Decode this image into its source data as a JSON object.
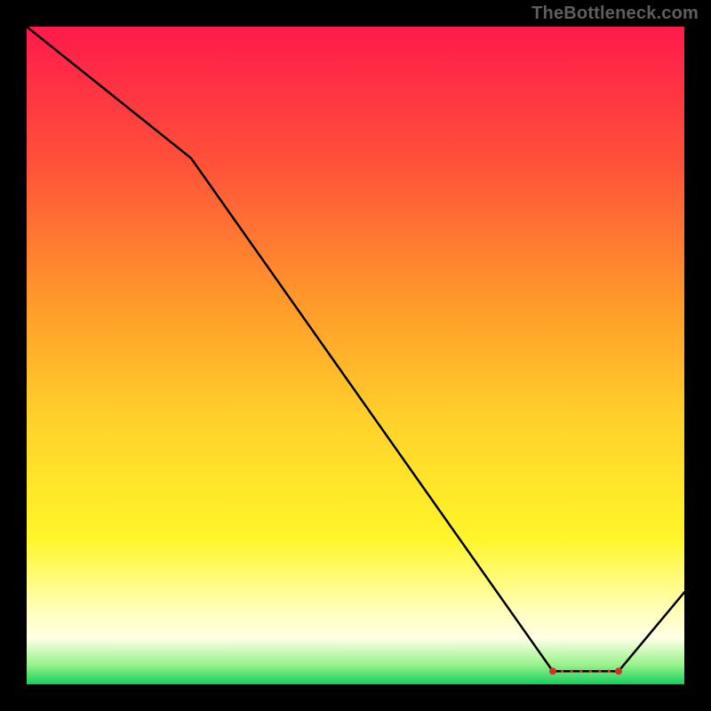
{
  "watermark": "TheBottleneck.com",
  "accent_line_color": "#000000",
  "marker_color": "#d2312a",
  "chart_data": {
    "type": "line",
    "title": "",
    "xlabel": "",
    "ylabel": "",
    "xlim": [
      0,
      100
    ],
    "ylim": [
      0,
      100
    ],
    "x": [
      0,
      25,
      80,
      90,
      100
    ],
    "y": [
      100,
      80,
      2,
      2,
      14
    ],
    "optimal_range": {
      "x_start": 80,
      "x_end": 90,
      "y": 2
    },
    "gradient_stops": [
      {
        "offset": 0.0,
        "color": "#ff1a4b"
      },
      {
        "offset": 0.2,
        "color": "#ff4f3a"
      },
      {
        "offset": 0.42,
        "color": "#ff9a2a"
      },
      {
        "offset": 0.6,
        "color": "#ffd22a"
      },
      {
        "offset": 0.78,
        "color": "#fff62a"
      },
      {
        "offset": 0.88,
        "color": "#ffffb0"
      },
      {
        "offset": 0.93,
        "color": "#ffffe6"
      },
      {
        "offset": 0.97,
        "color": "#9af28c"
      },
      {
        "offset": 1.0,
        "color": "#12d05e"
      }
    ]
  }
}
